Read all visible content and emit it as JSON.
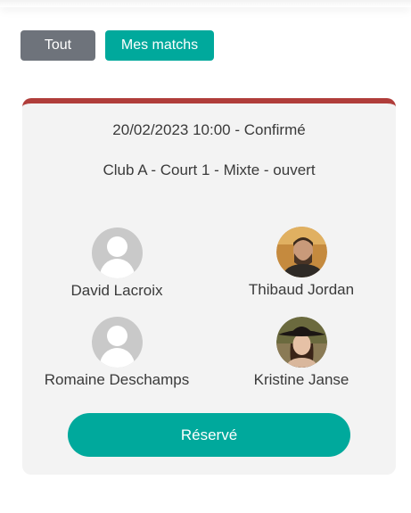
{
  "filters": {
    "all_label": "Tout",
    "mine_label": "Mes matchs"
  },
  "match": {
    "datetime_status": "20/02/2023 10:00 - Confirmé",
    "details": "Club A - Court 1 - Mixte - ouvert",
    "players": [
      {
        "name": "David Lacroix",
        "avatar": "default-avatar-icon"
      },
      {
        "name": "Thibaud Jordan",
        "avatar": "photo"
      },
      {
        "name": "Romaine Deschamps",
        "avatar": "default-avatar-icon"
      },
      {
        "name": "Kristine Janse",
        "avatar": "photo"
      }
    ],
    "reserve_label": "Réservé"
  },
  "colors": {
    "accent": "#00a99c",
    "filter_inactive": "#6e737b",
    "card_top_border": "#b03d3a",
    "card_bg": "#f3f3f3"
  }
}
